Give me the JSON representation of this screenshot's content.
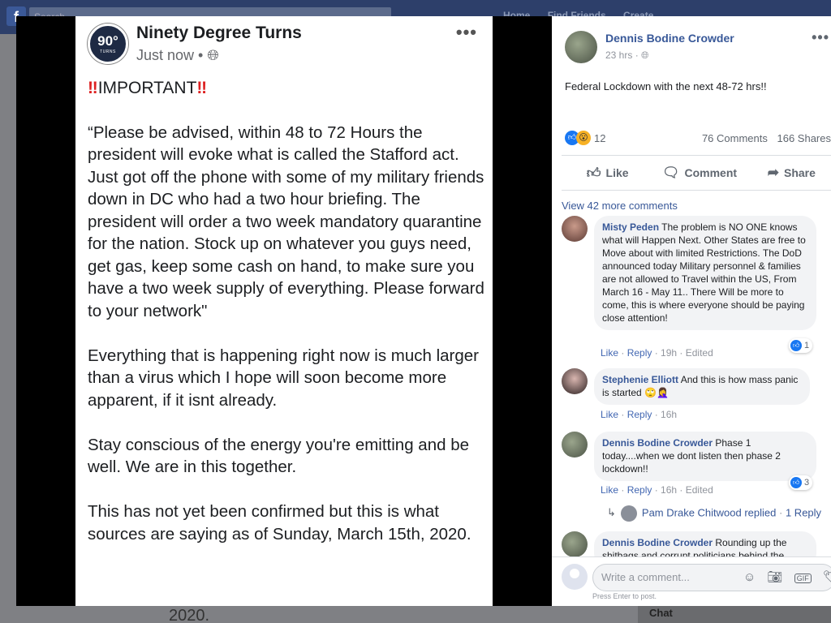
{
  "background": {
    "search_placeholder": "Search",
    "nav": [
      "Home",
      "Find Friends",
      "Create"
    ],
    "bottom_text": "2020.",
    "chat_label": "Chat"
  },
  "photo": {
    "page_name": "Ninety Degree Turns",
    "logo_text": "90°",
    "logo_subtext": "TURNS",
    "time": "Just now",
    "important_label": "IMPORTANT",
    "paragraphs": [
      "“Please be advised, within 48 to 72 Hours the president will evoke what is called the Stafford act. Just got off the phone with some of my military friends down in DC who had a two hour briefing. The president will order a two week mandatory quarantine for the nation. Stock up on whatever you guys need, get gas, keep some cash on hand, to make sure you have a two week supply of everything. Please forward to your network\"",
      "Everything that is happening right now is much larger than a virus which I hope will soon become more apparent, if it isnt already.",
      "Stay conscious of the energy you're emitting and be well. We are in this together.",
      "This has not yet been confirmed but this is what sources are saying as of Sunday, March 15th, 2020."
    ]
  },
  "post": {
    "author": "Dennis Bodine Crowder",
    "time": "23 hrs",
    "text": "Federal Lockdown with the next 48-72 hrs!!",
    "reaction_count": "12",
    "comments_count": "76 Comments",
    "shares_count": "166 Shares",
    "actions": {
      "like": "Like",
      "comment": "Comment",
      "share": "Share"
    },
    "view_more": "View 42 more comments"
  },
  "comments": [
    {
      "name": "Misty Peden",
      "text": "The problem is NO ONE knows what will Happen Next. Other States are free to Move about with limited Restrictions. The DoD announced today Military personnel & families are not allowed to Travel within the US, From March 16 - May 11.. There Will be more to come, this is where everyone should be paying close attention!",
      "like": "Like",
      "reply": "Reply",
      "time": "19h",
      "edited": "Edited",
      "reactions": "1"
    },
    {
      "name": "Stephenie Elliott",
      "text": "And this is how mass panic is started 🙄🤦‍♀️",
      "like": "Like",
      "reply": "Reply",
      "time": "16h"
    },
    {
      "name": "Dennis Bodine Crowder",
      "text": "Phase 1 today....when we dont listen then phase 2 lockdown!!",
      "like": "Like",
      "reply": "Reply",
      "time": "16h",
      "edited": "Edited",
      "reactions": "3"
    },
    {
      "name": "Dennis Bodine Crowder",
      "text": "Rounding up the shitbags and corrupt politicians behind the"
    }
  ],
  "replied": {
    "text": "Pam Drake Chitwood replied",
    "count": "1 Reply"
  },
  "composer": {
    "placeholder": "Write a comment...",
    "hint": "Press Enter to post."
  },
  "colors": {
    "link": "#385898",
    "like_blue": "#1877f2",
    "important_red": "#d22222"
  }
}
